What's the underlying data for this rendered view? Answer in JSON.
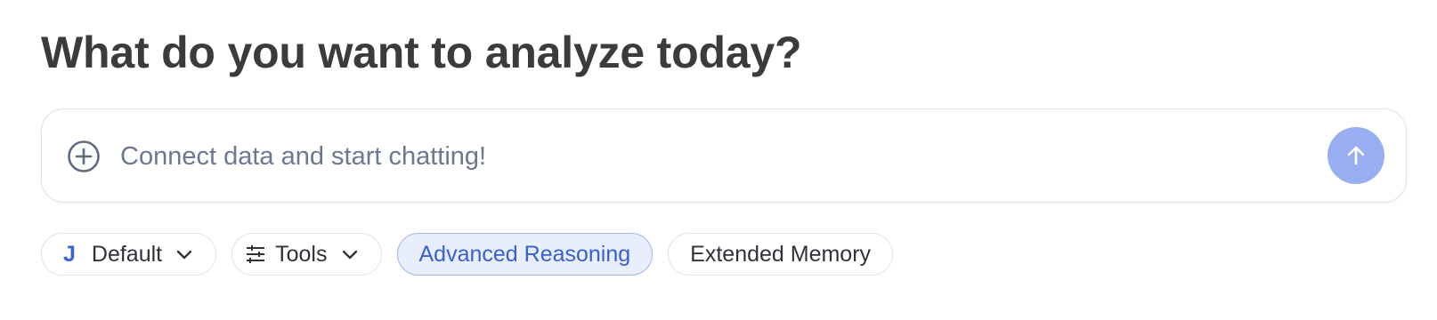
{
  "header": {
    "title": "What do you want to analyze today?"
  },
  "composer": {
    "placeholder": "Connect data and start chatting!",
    "attach_icon": "plus-circle-icon",
    "send_icon": "arrow-up-icon",
    "send_color": "#98aef0"
  },
  "chips": {
    "model": {
      "letter": "J",
      "label": "Default",
      "icon": "chevron-down-icon"
    },
    "tools": {
      "label": "Tools",
      "icon": "sliders-icon"
    },
    "advanced_reasoning": {
      "label": "Advanced Reasoning",
      "active": true,
      "accent": "#3760d2"
    },
    "extended_memory": {
      "label": "Extended Memory",
      "active": false
    }
  }
}
